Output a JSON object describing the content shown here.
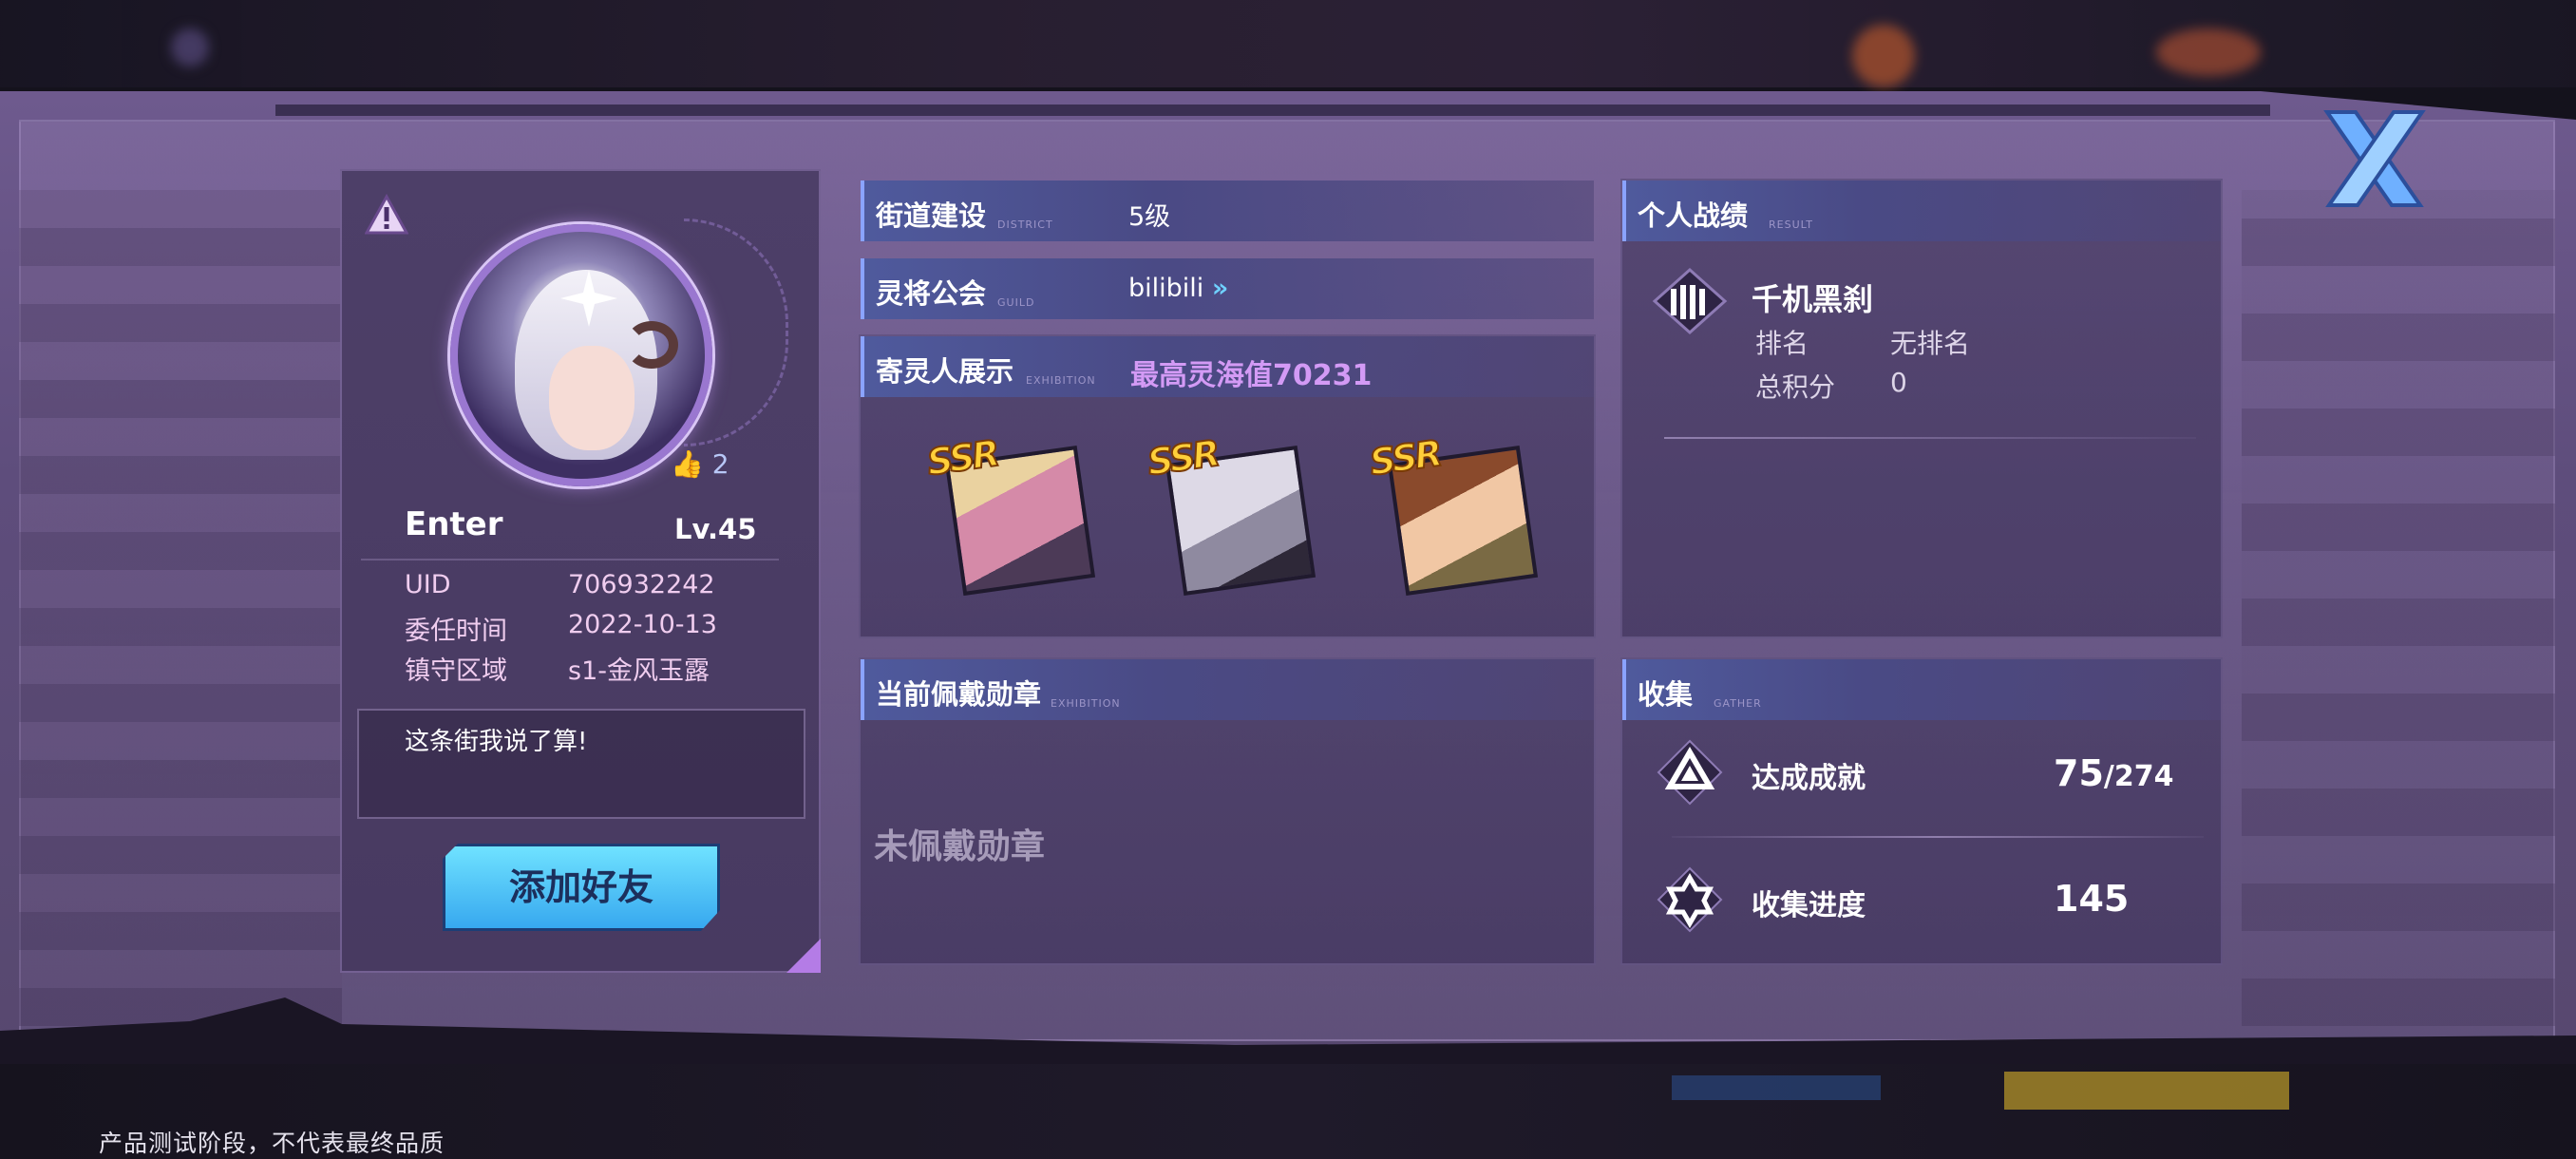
{
  "footer": {
    "disclaimer": "产品测试阶段，不代表最终品质"
  },
  "profile": {
    "name": "Enter",
    "level": "Lv.45",
    "likes": "2",
    "uid_label": "UID",
    "uid": "706932242",
    "commission_label": "委任时间",
    "commission_date": "2022-10-13",
    "region_label": "镇守区域",
    "region": "s1-金风玉露",
    "motto": "这条街我说了算!",
    "add_friend": "添加好友"
  },
  "district": {
    "title": "街道建设",
    "sub": "DISTRICT",
    "value": "5级"
  },
  "guild": {
    "title": "灵将公会",
    "sub": "GUILD",
    "value": "bilibili"
  },
  "exhibition": {
    "title": "寄灵人展示",
    "sub": "EXHIBITION",
    "best": "最高灵海值70231",
    "heroes": [
      {
        "rarity": "SSR",
        "color": "#c9708f"
      },
      {
        "rarity": "SSR",
        "color": "#b8b3c2"
      },
      {
        "rarity": "SSR",
        "color": "#b86b3d"
      }
    ]
  },
  "medal": {
    "title": "当前佩戴勋章",
    "sub": "EXHIBITION",
    "empty": "未佩戴勋章"
  },
  "result": {
    "title": "个人战绩",
    "sub": "RESULT",
    "mode": "千机黑刹",
    "rank_label": "排名",
    "rank_value": "无排名",
    "score_label": "总积分",
    "score_value": "0"
  },
  "gather": {
    "title": "收集",
    "sub": "GATHER",
    "achievement_label": "达成成就",
    "achievement_value": "75",
    "achievement_total": "/274",
    "progress_label": "收集进度",
    "progress_value": "145"
  },
  "colors": {
    "accent": "#d39af5",
    "button": "#37a8ef",
    "panel": "#5e4d7c"
  }
}
